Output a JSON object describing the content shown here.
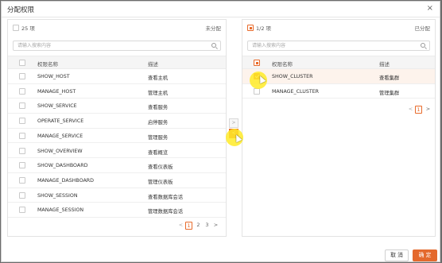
{
  "dialog": {
    "title": "分配权限",
    "close_glyph": "×"
  },
  "left": {
    "count": "25 项",
    "status": "未分配",
    "search_placeholder": "请输入搜索内容",
    "col_name": "权限名称",
    "col_desc": "描述",
    "rows": [
      {
        "name": "SHOW_HOST",
        "desc": "查看主机"
      },
      {
        "name": "MANAGE_HOST",
        "desc": "管理主机"
      },
      {
        "name": "SHOW_SERVICE",
        "desc": "查看服务"
      },
      {
        "name": "OPERATE_SERVICE",
        "desc": "启停服务"
      },
      {
        "name": "MANAGE_SERVICE",
        "desc": "管理服务"
      },
      {
        "name": "SHOW_OVERVIEW",
        "desc": "查看概览"
      },
      {
        "name": "SHOW_DASHBOARD",
        "desc": "查看仪表板"
      },
      {
        "name": "MANAGE_DASHBOARD",
        "desc": "管理仪表板"
      },
      {
        "name": "SHOW_SESSION",
        "desc": "查看数据库会话"
      },
      {
        "name": "MANAGE_SESSION",
        "desc": "管理数据库会话"
      }
    ],
    "pager": {
      "prev": "<",
      "pages": [
        "1",
        "2",
        "3"
      ],
      "next": ">"
    }
  },
  "right": {
    "count": "1/2 项",
    "status": "已分配",
    "search_placeholder": "请输入搜索内容",
    "col_name": "权限名称",
    "col_desc": "描述",
    "rows": [
      {
        "name": "SHOW_CLUSTER",
        "desc": "查看集群"
      },
      {
        "name": "MANAGE_CLUSTER",
        "desc": "管理集群"
      }
    ],
    "pager": {
      "prev": "<",
      "pages": [
        "1"
      ],
      "next": ">"
    }
  },
  "transfer": {
    "to_left": ">",
    "to_right": "<"
  },
  "footer": {
    "cancel": "取 消",
    "ok": "确 定"
  },
  "colors": {
    "accent": "#e86a2a",
    "highlight": "#fdf3ec"
  }
}
